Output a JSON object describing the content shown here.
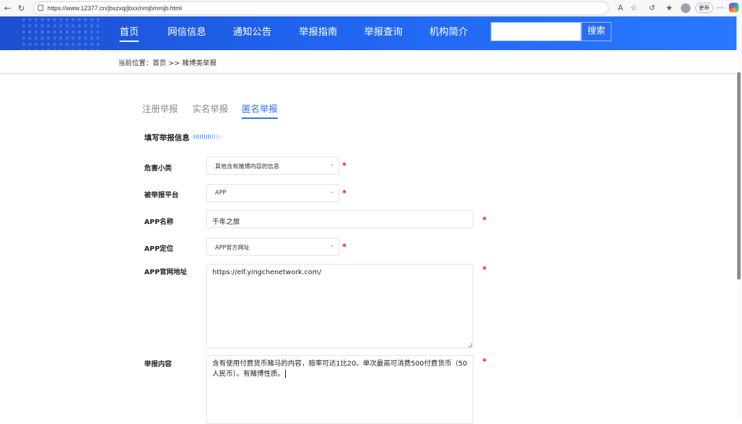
{
  "browser": {
    "url": "https://www.12377.cn/jbxzxq/jbxx/nmjb/nmjb.html",
    "update_label": "更新",
    "more_label": "···"
  },
  "header": {
    "menu": [
      {
        "label": "首页"
      },
      {
        "label": "网信信息"
      },
      {
        "label": "通知公告"
      },
      {
        "label": "举报指南"
      },
      {
        "label": "举报查询"
      },
      {
        "label": "机构简介"
      }
    ],
    "search": {
      "placeholder": "",
      "button_label": "搜索"
    }
  },
  "breadcrumb": {
    "text": "当前位置：首页 >> 赌博类举报"
  },
  "tabs": [
    {
      "label": "注册举报"
    },
    {
      "label": "实名举报"
    },
    {
      "label": "匿名举报"
    }
  ],
  "section": {
    "title": "填写举报信息"
  },
  "form": {
    "harm_category": {
      "label": "危害小类",
      "value": "其他含有赌博内容的信息"
    },
    "platform": {
      "label": "被举报平台",
      "value": "APP"
    },
    "app_name": {
      "label": "APP名称",
      "value": "千年之旅"
    },
    "app_locate": {
      "label": "APP定位",
      "value": "APP官方网址"
    },
    "app_url": {
      "label": "APP官网地址",
      "value": "https://elf.yingchenetwork.com/"
    },
    "content": {
      "label": "举报内容",
      "value": "含有使用付费货币赌马的内容，赔率可达1比20。单次最高可消费500付费货币（50人民币）。有赌博性质。"
    },
    "required_mark": "*"
  },
  "colors": {
    "accent": "#2a6df5",
    "header": "#1f63ee",
    "required": "#e02020"
  }
}
